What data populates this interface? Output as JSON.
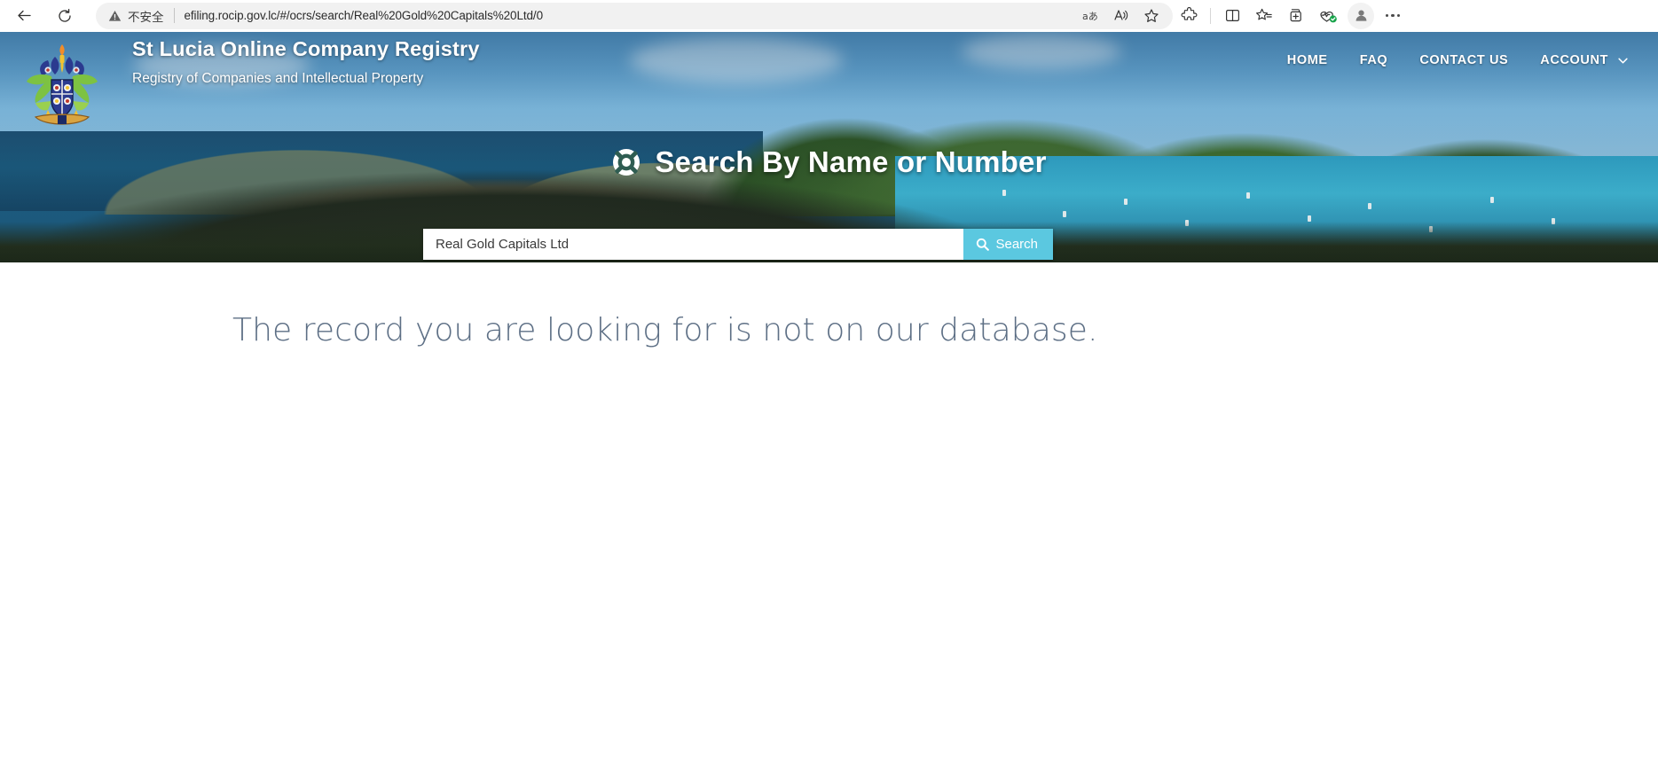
{
  "browser": {
    "back_icon": "back-arrow-icon",
    "reload_icon": "reload-icon",
    "security_label": "不安全",
    "url": "efiling.rocip.gov.lc/#/ocrs/search/Real%20Gold%20Capitals%20Ltd/0",
    "toolbar_icons": [
      {
        "name": "translate-icon",
        "glyph": "aあ"
      },
      {
        "name": "read-aloud-icon",
        "glyph": "A"
      },
      {
        "name": "favorite-star-icon",
        "glyph": "☆"
      },
      {
        "name": "extensions-icon",
        "glyph": "puzzle"
      },
      {
        "name": "split-screen-icon",
        "glyph": "split"
      },
      {
        "name": "collections-icon",
        "glyph": "collections"
      },
      {
        "name": "add-to-collections-icon",
        "glyph": "add"
      },
      {
        "name": "browser-essentials-icon",
        "glyph": "heartbeat"
      },
      {
        "name": "profile-avatar-icon",
        "glyph": "person"
      },
      {
        "name": "settings-more-icon",
        "glyph": "…"
      }
    ]
  },
  "site": {
    "title": "St Lucia Online Company Registry",
    "subtitle": "Registry of Companies and Intellectual Property",
    "crest_alt": "st-lucia-coat-of-arms"
  },
  "nav": {
    "items": [
      {
        "label": "HOME",
        "name": "nav-home"
      },
      {
        "label": "FAQ",
        "name": "nav-faq"
      },
      {
        "label": "CONTACT US",
        "name": "nav-contact-us"
      },
      {
        "label": "ACCOUNT",
        "name": "nav-account"
      }
    ]
  },
  "search": {
    "heading": "Search By Name or Number",
    "heading_icon": "life-ring-icon",
    "value": "Real Gold Capitals Ltd",
    "placeholder": "",
    "button_label": "Search",
    "button_icon": "magnifier-icon"
  },
  "main": {
    "message": "The record you are looking for is not on our database."
  },
  "colors": {
    "search_button": "#5bc8e0",
    "message_text": "#5d6f85",
    "banner_sky": "#5fa0cd",
    "bay_water": "#3fb7d6"
  }
}
